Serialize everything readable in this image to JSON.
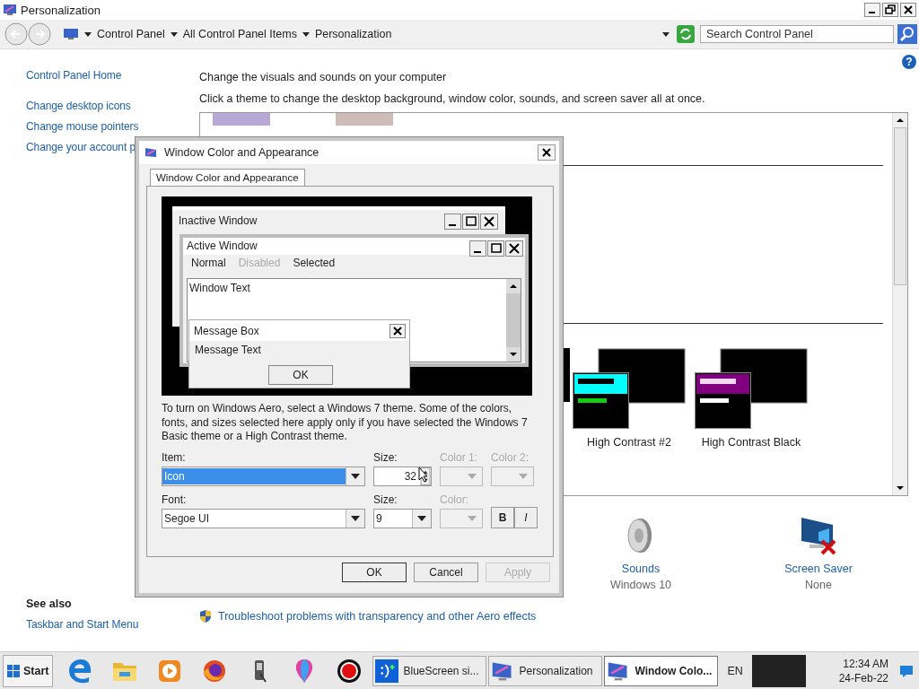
{
  "window": {
    "title": "Personalization"
  },
  "address_bar": {
    "breadcrumb": [
      "Control Panel",
      "All Control Panel Items",
      "Personalization"
    ],
    "search": {
      "placeholder": "Search Control Panel"
    }
  },
  "help": {
    "label": "?"
  },
  "sidebar": {
    "links": [
      "Control Panel Home",
      "Change desktop icons",
      "Change mouse pointers",
      "Change your account p"
    ],
    "see_also": {
      "title": "See also",
      "links": [
        "Taskbar and Start Menu"
      ]
    }
  },
  "main": {
    "heading": "Change the visuals and sounds on your computer",
    "subheading": "Click a theme to change the desktop background, window color, sounds, and screen saver all at once.",
    "top_swatches": [
      {
        "color": "#b8a8d8"
      },
      {
        "color": "#cdbcb8"
      }
    ],
    "themes": [
      {
        "label": "High Contrast #2",
        "color": "#00ffff"
      },
      {
        "label": "High Contrast Black",
        "color": "#800080"
      }
    ],
    "settings": [
      {
        "kind": "sounds",
        "label": "Sounds",
        "value": "Windows 10"
      },
      {
        "kind": "screensaver",
        "label": "Screen Saver",
        "value": "None"
      }
    ],
    "footer_link": "Troubleshoot problems with transparency and other Aero effects"
  },
  "dialog": {
    "title": "Window Color and Appearance",
    "tabs": [
      {
        "label": "Window Color and Appearance",
        "selected": true
      }
    ],
    "preview": {
      "inactive_title": "Inactive Window",
      "active_title": "Active Window",
      "menu": [
        {
          "label": "Normal",
          "disabled": false
        },
        {
          "label": "Disabled",
          "disabled": true
        },
        {
          "label": "Selected",
          "disabled": false
        }
      ],
      "window_text": "Window Text",
      "message_box": {
        "title": "Message Box",
        "text": "Message Text",
        "button": "OK"
      }
    },
    "note": "To turn on Windows Aero, select a Windows 7 theme.  Some of the colors, fonts, and sizes selected here apply only if you have selected the Windows 7 Basic theme or a High Contrast theme.",
    "rows": [
      [
        {
          "kind": "combo",
          "label": "Item:",
          "value": "Icon",
          "highlighted": true,
          "disabled": false
        },
        {
          "kind": "spin",
          "label": "Size:",
          "value": "32",
          "disabled": false
        },
        {
          "kind": "color",
          "label": "Color 1:",
          "disabled": true
        },
        {
          "kind": "color",
          "label": "Color 2:",
          "disabled": true
        }
      ],
      [
        {
          "kind": "combo",
          "label": "Font:",
          "value": "Segoe UI",
          "highlighted": false,
          "disabled": false
        },
        {
          "kind": "small_combo",
          "label": "Size:",
          "value": "9",
          "disabled": false
        },
        {
          "kind": "color",
          "label": "Color:",
          "disabled": true
        },
        {
          "kind": "styles",
          "bold": "B",
          "italic": "I"
        }
      ]
    ],
    "buttons": [
      {
        "label": "OK",
        "disabled": false,
        "default": true
      },
      {
        "label": "Cancel",
        "disabled": false,
        "default": false
      },
      {
        "label": "Apply",
        "disabled": true,
        "default": false
      }
    ]
  },
  "taskbar": {
    "start": "Start",
    "pinned": [
      {
        "kind": "edge"
      },
      {
        "kind": "folder"
      },
      {
        "kind": "media"
      },
      {
        "kind": "firefox"
      },
      {
        "kind": "usb"
      },
      {
        "kind": "balloon"
      },
      {
        "kind": "record"
      }
    ],
    "tasks": [
      {
        "kind": "bluescreen",
        "label": "BlueScreen si...",
        "selected": false
      },
      {
        "kind": "monitor",
        "label": "Personalization",
        "selected": false
      },
      {
        "kind": "monitor",
        "label": "Window Colo...",
        "selected": true
      }
    ],
    "language": "EN",
    "time": "12:34 AM",
    "date": "24-Feb-22"
  }
}
